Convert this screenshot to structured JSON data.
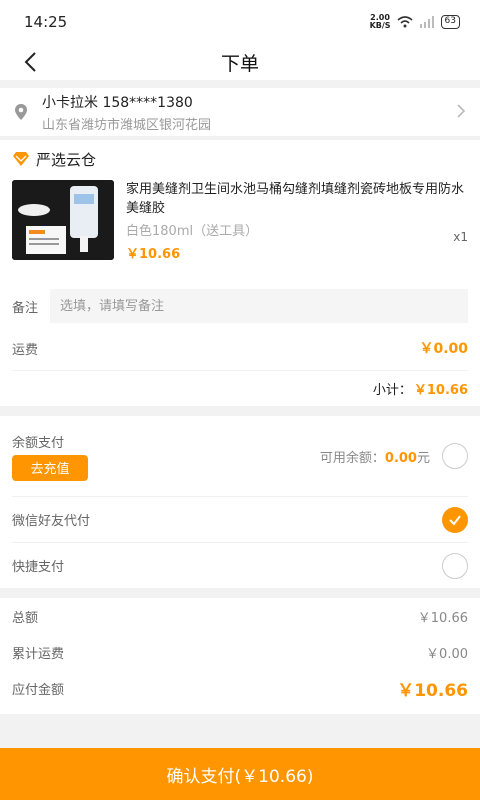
{
  "status": {
    "time": "14:25",
    "net_speed": "2.00",
    "net_unit": "KB/S",
    "battery": "63"
  },
  "nav": {
    "title": "下单"
  },
  "address": {
    "name_phone": "小卡拉米  158****1380",
    "detail": "山东省潍坊市潍城区银河花园"
  },
  "shop": {
    "name": "严选云仓"
  },
  "product": {
    "title": "家用美缝剂卫生间水池马桶勾缝剂填缝剂瓷砖地板专用防水美缝胶",
    "spec": "白色180ml（送工具）",
    "price": "￥10.66",
    "qty": "x1"
  },
  "order": {
    "note_label": "备注",
    "note_placeholder": "选填，请填写备注",
    "shipping_label": "运费",
    "shipping_value": "￥0.00",
    "subtotal_label": "小计：",
    "subtotal_value": "￥10.66"
  },
  "payment": {
    "balance_label": "余额支付",
    "recharge_label": "去充值",
    "available_label": "可用余额：",
    "available_value": "0.00",
    "available_unit": "元",
    "wechat_friend_label": "微信好友代付",
    "quick_pay_label": "快捷支付",
    "selected": "wechat_friend"
  },
  "summary": {
    "total_label": "总额",
    "total_value": "￥10.66",
    "freight_label": "累计运费",
    "freight_value": "￥0.00",
    "payable_label": "应付金额",
    "payable_value": "￥10.66"
  },
  "confirm_label": "确认支付(￥10.66)",
  "colors": {
    "accent": "#ff9500",
    "background": "#f2f2f2"
  }
}
